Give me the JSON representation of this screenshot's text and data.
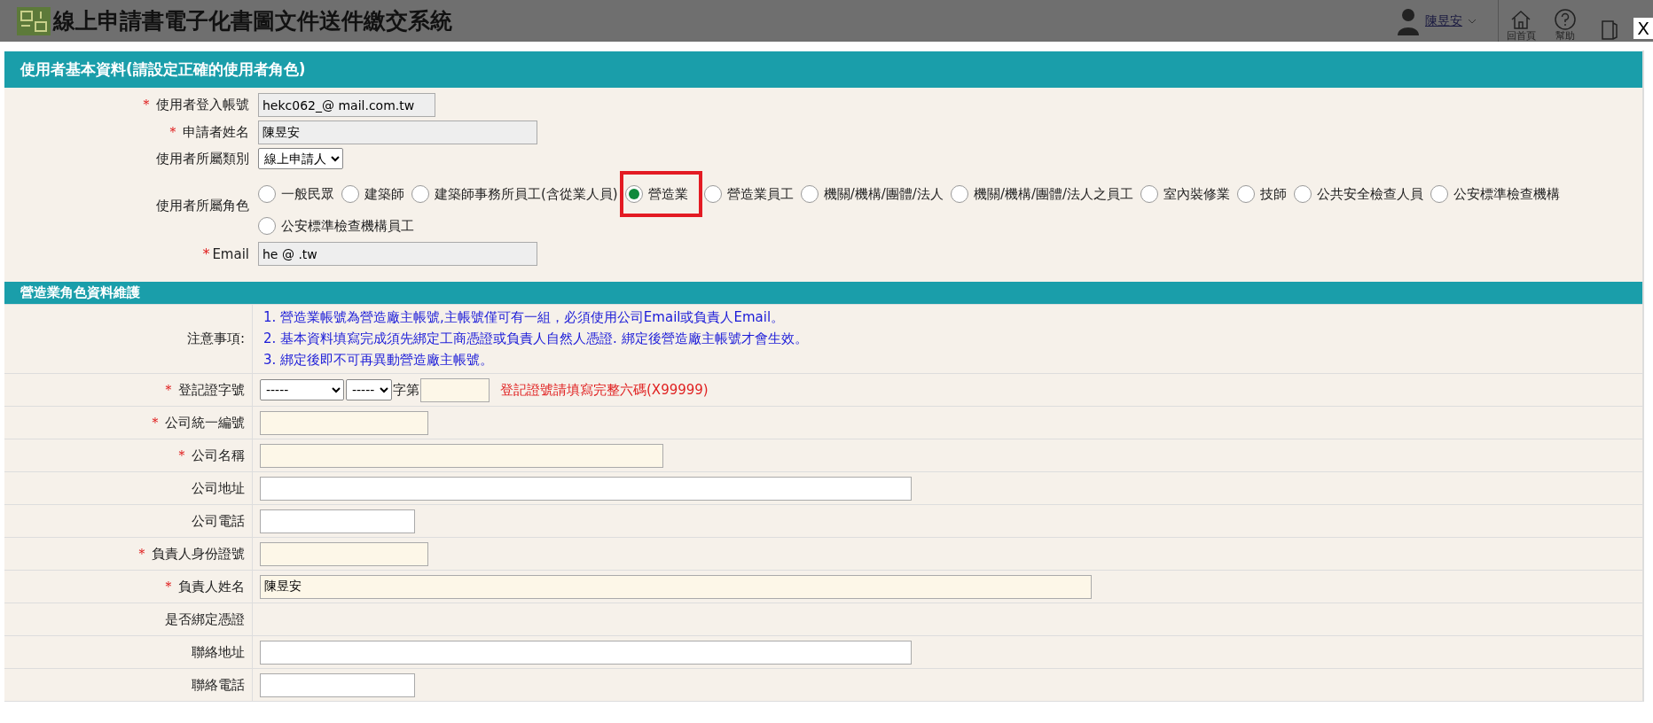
{
  "header": {
    "title": "線上申請書電子化書圖文件送件繳交系統",
    "user": "陳昱安",
    "nav": [
      {
        "kind": "home",
        "label": "回首頁"
      },
      {
        "kind": "help",
        "label": "幫助"
      },
      {
        "kind": "exit"
      }
    ],
    "close": "X"
  },
  "section1": {
    "title": "使用者基本資料(請設定正確的使用者角色)",
    "fields": [
      {
        "kind": "input",
        "label": "使用者登入帳號",
        "mark": "＊",
        "value": "hekc062_@ mail.com.tw",
        "readonly": true
      },
      {
        "kind": "input",
        "label": "申請者姓名",
        "mark": "＊",
        "value": "陳昱安",
        "readonly": true
      },
      {
        "kind": "select",
        "label": "使用者所屬類別",
        "value": "線上申請人"
      },
      {
        "kind": "radios",
        "label": "使用者所屬角色",
        "options": [
          {
            "label": "一般民眾",
            "selected": false,
            "highlighted": false
          },
          {
            "label": "建築師",
            "selected": false,
            "highlighted": false
          },
          {
            "label": "建築師事務所員工(含從業人員)",
            "selected": false,
            "highlighted": false
          },
          {
            "label": "營造業",
            "selected": true,
            "highlighted": true
          },
          {
            "label": "營造業員工",
            "selected": false,
            "highlighted": false
          },
          {
            "label": "機關/機構/團體/法人",
            "selected": false,
            "highlighted": false
          },
          {
            "label": "機關/機構/團體/法人之員工",
            "selected": false,
            "highlighted": false
          },
          {
            "label": "室內裝修業",
            "selected": false,
            "highlighted": false
          },
          {
            "label": "技師",
            "selected": false,
            "highlighted": false
          },
          {
            "label": "公共安全檢查人員",
            "selected": false,
            "highlighted": false
          },
          {
            "label": "公安標準檢查機構",
            "selected": false,
            "highlighted": false
          },
          {
            "label": "公安標準檢查機構員工",
            "selected": false,
            "highlighted": false
          }
        ]
      },
      {
        "kind": "input",
        "label": "Email",
        "mark": "*",
        "value": "he @ .tw",
        "readonly": true
      }
    ]
  },
  "section2": {
    "title": "營造業角色資料維護",
    "rows": [
      {
        "kind": "notes",
        "label": "注意事項:",
        "lines": [
          "1. 營造業帳號為營造廠主帳號,主帳號僅可有一組，必須使用公司Email或負責人Email。",
          "2. 基本資料填寫完成須先綁定工商憑證或負責人自然人憑證. 綁定後營造廠主帳號才會生效。",
          "3. 綁定後即不可再異動營造廠主帳號。"
        ]
      },
      {
        "kind": "reg",
        "label": "登記證字號",
        "required": true,
        "mark": "＊",
        "selects": [
          "-----",
          "-----"
        ],
        "joiner": "字第",
        "hint": "登記證號請填寫完整六碼(X99999)"
      },
      {
        "kind": "input",
        "label": "公司統一編號",
        "required": true,
        "mark": "＊"
      },
      {
        "kind": "input",
        "label": "公司名稱",
        "required": true,
        "mark": "＊"
      },
      {
        "kind": "input",
        "label": "公司地址",
        "required": false
      },
      {
        "kind": "input",
        "label": "公司電話",
        "required": false
      },
      {
        "kind": "input",
        "label": "負責人身份證號",
        "required": true,
        "mark": "＊"
      },
      {
        "kind": "input",
        "label": "負責人姓名",
        "required": true,
        "mark": "＊",
        "value": "陳昱安"
      },
      {
        "kind": "text",
        "label": "是否綁定憑證"
      },
      {
        "kind": "input",
        "label": "聯絡地址",
        "required": false
      },
      {
        "kind": "input",
        "label": "聯絡電話",
        "required": false
      }
    ]
  }
}
